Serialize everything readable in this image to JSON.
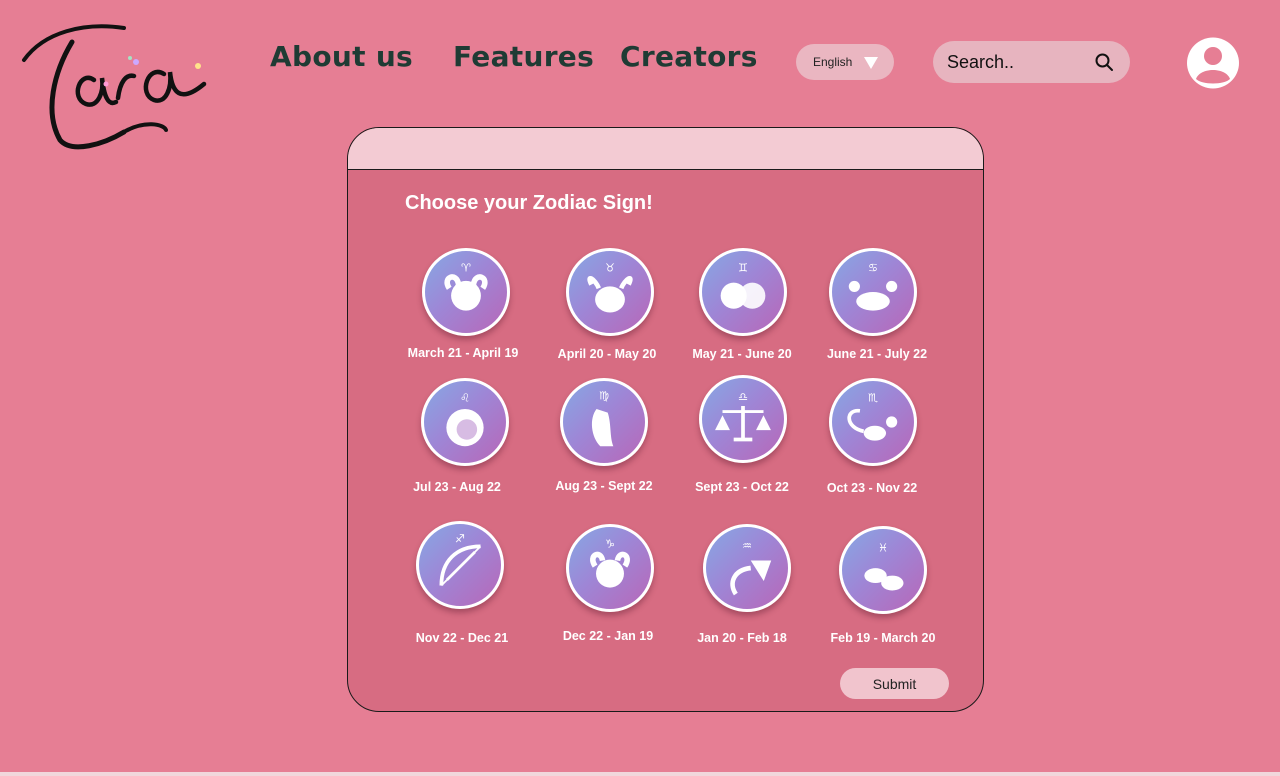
{
  "header": {
    "logo_text": "tara",
    "nav": [
      {
        "label": "About us"
      },
      {
        "label": "Features"
      },
      {
        "label": "Creators"
      }
    ],
    "language": {
      "selected": "English"
    },
    "search": {
      "placeholder": "Search.."
    }
  },
  "card": {
    "title": "Choose your Zodiac Sign!",
    "signs": [
      {
        "label": "March 21 - April 19",
        "icon": "aries-icon"
      },
      {
        "label": "April 20 - May 20",
        "icon": "taurus-icon"
      },
      {
        "label": "May 21 - June 20",
        "icon": "gemini-icon"
      },
      {
        "label": "June 21 - July 22",
        "icon": "cancer-icon"
      },
      {
        "label": "Jul 23 - Aug 22",
        "icon": "leo-icon"
      },
      {
        "label": "Aug 23 - Sept 22",
        "icon": "virgo-icon"
      },
      {
        "label": "Sept 23 - Oct 22",
        "icon": "libra-icon"
      },
      {
        "label": "Oct 23 - Nov 22",
        "icon": "scorpio-icon"
      },
      {
        "label": "Nov 22 - Dec 21",
        "icon": "sagittarius-icon"
      },
      {
        "label": "Dec 22 - Jan 19",
        "icon": "capricorn-icon"
      },
      {
        "label": "Jan 20 - Feb 18",
        "icon": "aquarius-icon"
      },
      {
        "label": "Feb 19 - March 20",
        "icon": "pisces-icon"
      }
    ],
    "submit_label": "Submit"
  },
  "colors": {
    "background": "#e67e94",
    "card": "#d76c82",
    "card_header": "#f3cbd3",
    "nav_text": "#1f3b34",
    "circle_gradient_start": "#86a8e4",
    "circle_gradient_end": "#b867b8"
  }
}
